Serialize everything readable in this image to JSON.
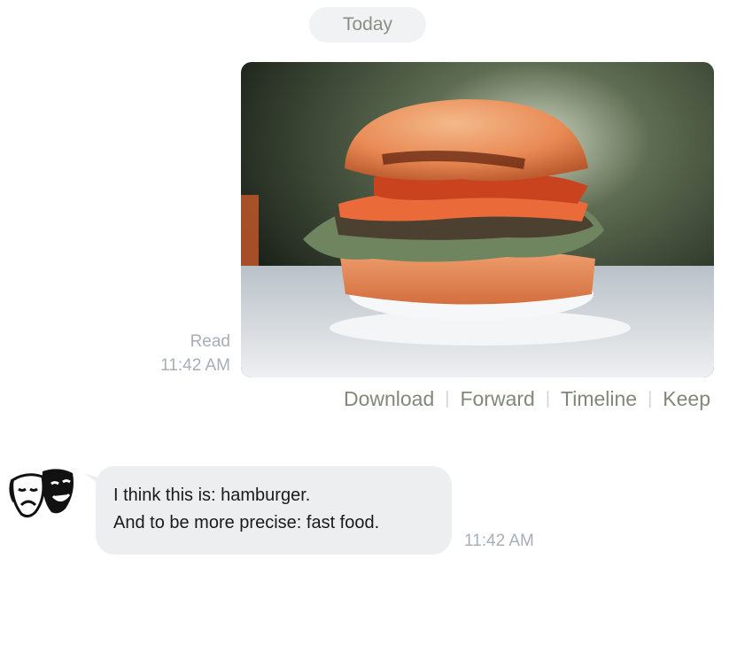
{
  "date_divider": "Today",
  "outgoing": {
    "image_subject": "hamburger photo",
    "read_status": "Read",
    "time": "11:42 AM"
  },
  "image_actions": [
    {
      "label": "Download"
    },
    {
      "label": "Forward"
    },
    {
      "label": "Timeline"
    },
    {
      "label": "Keep"
    }
  ],
  "incoming": {
    "avatar": "theater-masks-icon",
    "line1": "I think this is: hamburger.",
    "line2": "And to be more precise: fast food.",
    "time": "11:42 AM"
  },
  "colors": {
    "bubble": "#eceef0",
    "meta_text": "#a7aeb9",
    "action_text": "#808878"
  }
}
